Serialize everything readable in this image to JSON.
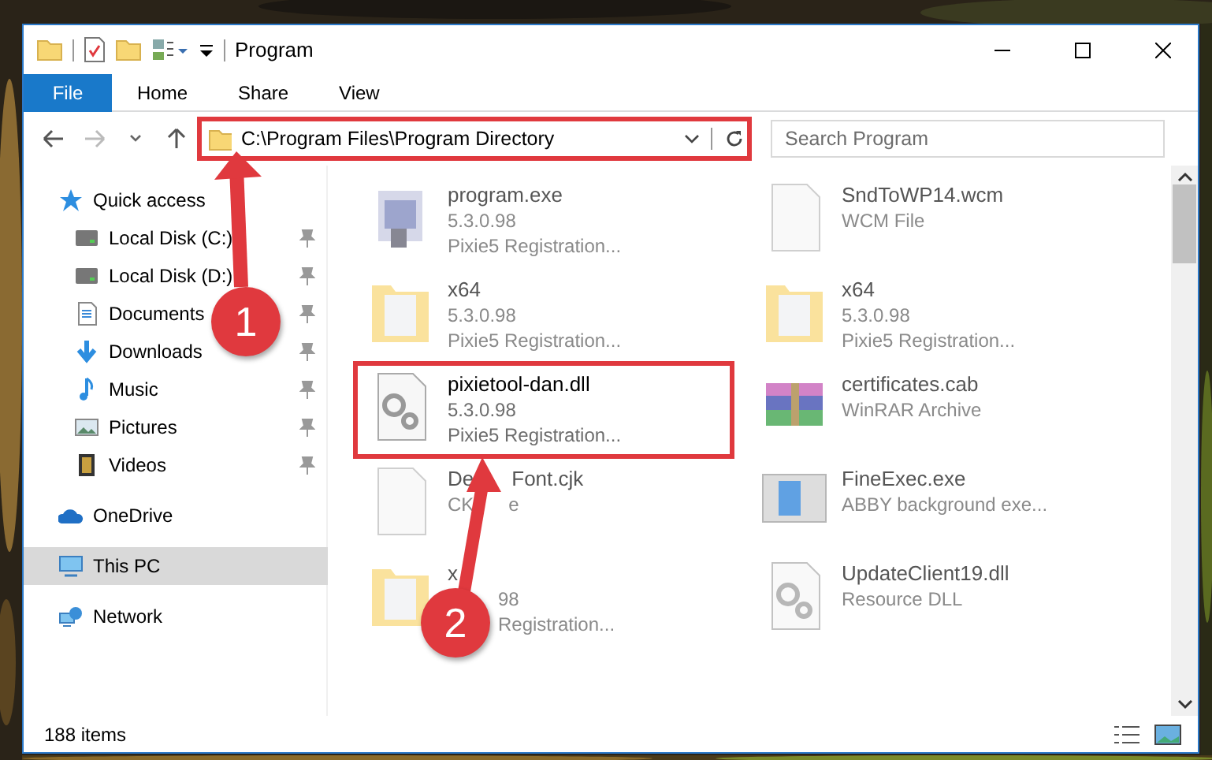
{
  "window": {
    "title": "Program"
  },
  "ribbon_tabs": [
    {
      "label": "File",
      "kind": "file"
    },
    {
      "label": "Home",
      "kind": "tab"
    },
    {
      "label": "Share",
      "kind": "tab"
    },
    {
      "label": "View",
      "kind": "tab"
    }
  ],
  "address": {
    "path": "C:\\Program Files\\Program Directory",
    "highlighted": true
  },
  "search": {
    "placeholder": "Search Program"
  },
  "nav": [
    {
      "label": "Quick access",
      "kind": "star",
      "selected": false,
      "children": [
        {
          "label": "Local Disk (C:)",
          "kind": "drive",
          "pinned": true,
          "selected": false
        },
        {
          "label": "Local Disk (D:)",
          "kind": "drive",
          "pinned": true,
          "selected": false
        },
        {
          "label": "Documents",
          "kind": "documents",
          "pinned": true,
          "selected": false
        },
        {
          "label": "Downloads",
          "kind": "downloads",
          "pinned": true,
          "selected": false
        },
        {
          "label": "Music",
          "kind": "music",
          "pinned": true,
          "selected": false
        },
        {
          "label": "Pictures",
          "kind": "pictures",
          "pinned": true,
          "selected": false
        },
        {
          "label": "Videos",
          "kind": "videos",
          "pinned": true,
          "selected": false
        }
      ]
    },
    {
      "label": "OneDrive",
      "kind": "cloud",
      "selected": false
    },
    {
      "label": "This PC",
      "kind": "pc",
      "selected": true
    },
    {
      "label": "Network",
      "kind": "network",
      "selected": false
    }
  ],
  "files": [
    {
      "name": [
        "program.exe"
      ],
      "details": [
        [
          "5.3.0.98"
        ],
        [
          "Pixie5 Registration..."
        ]
      ],
      "kind": "exe",
      "blurred": true,
      "highlighted": false
    },
    {
      "name": [
        "SndToWP14.wcm"
      ],
      "details": [
        [
          "WCM File"
        ]
      ],
      "kind": "blank",
      "blurred": true,
      "highlighted": false
    },
    {
      "name": [
        "x64"
      ],
      "details": [
        [
          "5.3.0.98"
        ],
        [
          "Pixie5 Registration..."
        ]
      ],
      "kind": "folder",
      "blurred": true,
      "highlighted": false
    },
    {
      "name": [
        "x64"
      ],
      "details": [
        [
          "5.3.0.98"
        ],
        [
          "Pixie5 Registration..."
        ]
      ],
      "kind": "folder",
      "blurred": true,
      "highlighted": false
    },
    {
      "name": [
        "pixietool-dan.dll"
      ],
      "details": [
        [
          "5.3.0.98"
        ],
        [
          "Pixie5 Registration..."
        ]
      ],
      "kind": "dll",
      "blurred": false,
      "highlighted": true
    },
    {
      "name": [
        "certificates.cab"
      ],
      "details": [
        [
          "WinRAR Archive"
        ]
      ],
      "kind": "archive",
      "blurred": true,
      "highlighted": false
    },
    {
      "name": [
        "De",
        "Font.cjk"
      ],
      "details": [
        [
          "CK",
          "e"
        ]
      ],
      "kind": "blank",
      "blurred": true,
      "highlighted": false
    },
    {
      "name": [
        "FineExec.exe"
      ],
      "details": [
        [
          "ABBY background exe..."
        ]
      ],
      "kind": "app",
      "blurred": true,
      "highlighted": false
    },
    {
      "name": [
        "x"
      ],
      "details": [
        [
          "98"
        ],
        [
          "Registration..."
        ]
      ],
      "kind": "folder",
      "blurred": true,
      "highlighted": false
    },
    {
      "name": [
        "UpdateClient19.dll"
      ],
      "details": [
        [
          "Resource DLL"
        ]
      ],
      "kind": "dll",
      "blurred": true,
      "highlighted": false
    }
  ],
  "annotations": [
    {
      "label": "1"
    },
    {
      "label": "2"
    }
  ],
  "status_bar": {
    "count": "188 items"
  }
}
